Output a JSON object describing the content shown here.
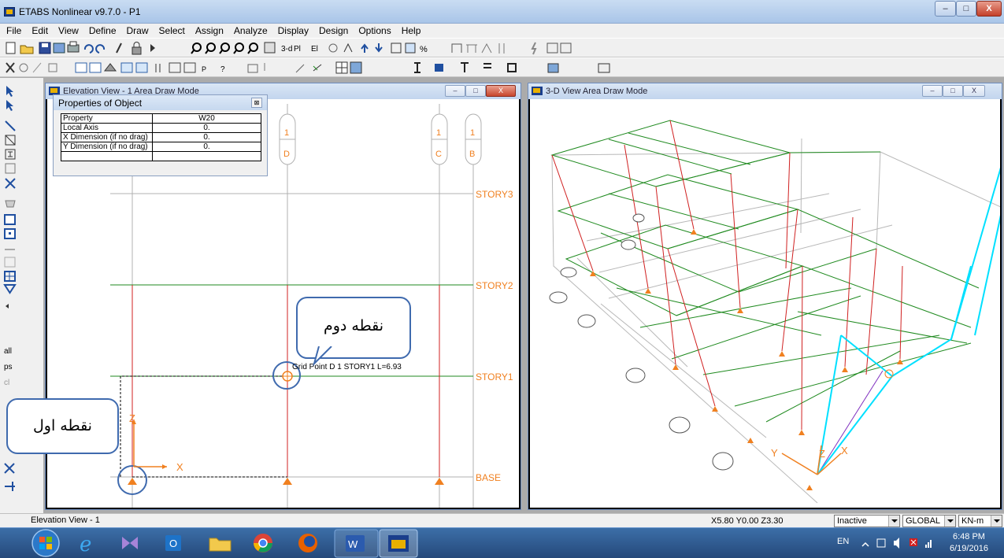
{
  "app": {
    "title": "ETABS Nonlinear v9.7.0 - P1",
    "window_controls": [
      "minimize",
      "maximize",
      "close"
    ]
  },
  "menu": [
    "File",
    "Edit",
    "View",
    "Define",
    "Draw",
    "Select",
    "Assign",
    "Analyze",
    "Display",
    "Design",
    "Options",
    "Help"
  ],
  "toolbar1_text": {
    "view3d": "3-d",
    "plan": "Pl濘",
    "elev": "Elev",
    "fraction": "⅟"
  },
  "elevation_window": {
    "title": "Elevation View - 1  Area Draw Mode",
    "grid_bubbles": [
      {
        "top": "1",
        "bottom": "D"
      },
      {
        "top": "1",
        "bottom": "C"
      },
      {
        "top": "1",
        "bottom": "B"
      }
    ],
    "story_labels": [
      "STORY3",
      "STORY2",
      "STORY1",
      "BASE"
    ],
    "snap_tip": "Grid Point  D  1  STORY1  L=6.93",
    "axis_labels": {
      "x": "X",
      "z": "Z"
    }
  },
  "properties": {
    "title": "Properties of Object",
    "rows": [
      {
        "label": "Property",
        "value": "W20"
      },
      {
        "label": "Local Axis",
        "value": "0."
      },
      {
        "label": "X Dimension (if no drag)",
        "value": "0."
      },
      {
        "label": "Y Dimension (if no drag)",
        "value": "0."
      },
      {
        "label": "",
        "value": ""
      }
    ]
  },
  "view3d_window": {
    "title": "3-D View  Area Draw Mode",
    "axis_labels": {
      "x": "X",
      "y": "Y",
      "z": "Z"
    }
  },
  "callouts": {
    "first_point": "نقطه اول",
    "second_point": "نقطه دوم"
  },
  "left_toolbar": {
    "labels": [
      "all",
      "ps",
      "cl"
    ]
  },
  "status": {
    "left": "Elevation View - 1",
    "coords": "X5.80  Y0.00  Z3.30",
    "mode": "Inactive",
    "coord_system": "GLOBAL",
    "units": "KN-m"
  },
  "taskbar": {
    "apps": [
      "start-orb",
      "internet-explorer",
      "visual-studio",
      "outlook",
      "file-explorer",
      "chrome",
      "firefox",
      "word",
      "etabs"
    ],
    "language": "EN",
    "time": "6:48 PM",
    "date": "6/19/2016"
  },
  "colors": {
    "grid_gray": "#B0B0B0",
    "frame_red": "#D02020",
    "beam_green": "#1F8A1F",
    "support_orange": "#F08020",
    "highlight_cyan": "#00E0FF",
    "callout_border": "#3F6AAE"
  }
}
